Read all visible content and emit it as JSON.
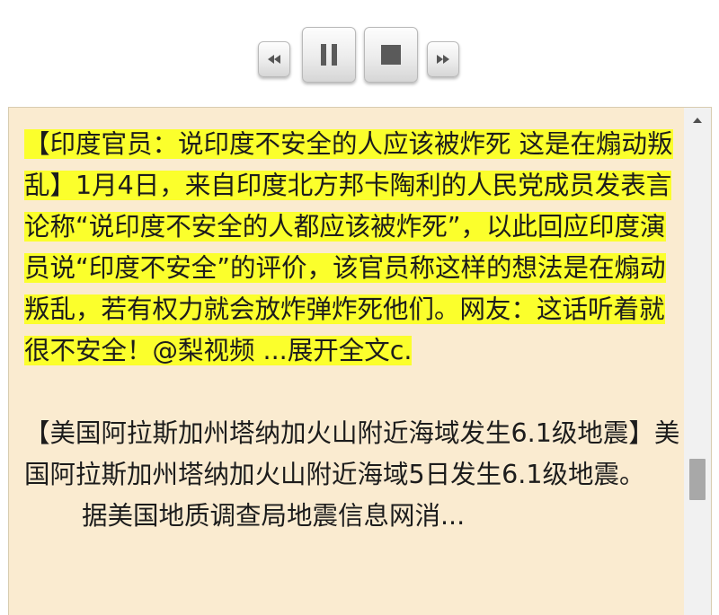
{
  "controls": {
    "rewind_icon": "rewind-icon",
    "pause_icon": "pause-icon",
    "stop_icon": "stop-icon",
    "forward_icon": "fast-forward-icon"
  },
  "article": {
    "highlighted_item": "【印度官员：说印度不安全的人应该被炸死 这是在煽动叛乱】1月4日，来自印度北方邦卡陶利的人民党成员发表言论称“说印度不安全的人都应该被炸死”，以此回应印度演员说“印度不安全”的评价，该官员称这样的想法是在煽动叛乱，若有权力就会放炸弹炸死他们。网友：这话听着就很不安全！@梨视频 ...展开全文c.",
    "second_item": "【美国阿拉斯加州塔纳加火山附近海域发生6.1级地震】美国阿拉斯加州塔纳加火山附近海域5日发生6.1级地震。",
    "second_item_sub": "据美国地质调查局地震信息网消..."
  },
  "scrollbar": {
    "position_fraction": 0.72
  },
  "colors": {
    "panel_background": "#faebd0",
    "highlight": "#fbff2c",
    "text": "#1c1c1c"
  }
}
